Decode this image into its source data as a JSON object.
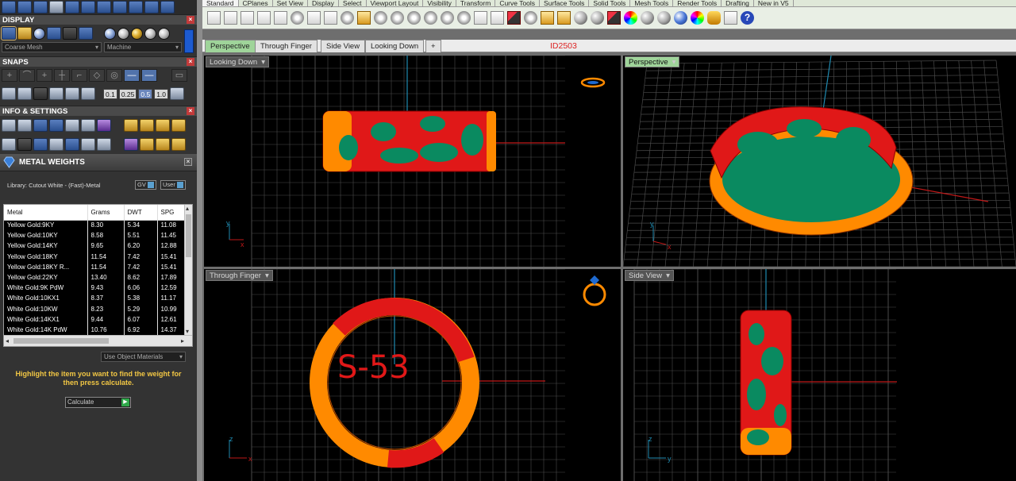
{
  "left_panel": {
    "display_section": {
      "title": "DISPLAY",
      "mesh_dropdown": "Coarse Mesh",
      "render_dropdown": "Machine"
    },
    "snaps_section": {
      "title": "SNAPS",
      "values": [
        "0.1",
        "0.25",
        "0.5",
        "1.0"
      ]
    },
    "info_section": {
      "title": "INFO & SETTINGS"
    },
    "metal_weights": {
      "title": "METAL WEIGHTS",
      "library_label": "Library: Cutout White - (Fast)-Metal",
      "gv_label": "GV",
      "user_label": "User",
      "columns": [
        "Metal",
        "Grams",
        "DWT",
        "SPG"
      ],
      "rows": [
        [
          "Yellow Gold:9KY",
          "8.30",
          "5.34",
          "11.08"
        ],
        [
          "Yellow Gold:10KY",
          "8.58",
          "5.51",
          "11.45"
        ],
        [
          "Yellow Gold:14KY",
          "9.65",
          "6.20",
          "12.88"
        ],
        [
          "Yellow Gold:18KY",
          "11.54",
          "7.42",
          "15.41"
        ],
        [
          "Yellow Gold:18KY R...",
          "11.54",
          "7.42",
          "15.41"
        ],
        [
          "Yellow Gold:22KY",
          "13.40",
          "8.62",
          "17.89"
        ],
        [
          "White Gold:9K PdW",
          "9.43",
          "6.06",
          "12.59"
        ],
        [
          "White Gold:10KX1",
          "8.37",
          "5.38",
          "11.17"
        ],
        [
          "White Gold:10KW",
          "8.23",
          "5.29",
          "10.99"
        ],
        [
          "White Gold:14KX1",
          "9.44",
          "6.07",
          "12.61"
        ],
        [
          "White Gold:14K PdW",
          "10.76",
          "6.92",
          "14.37"
        ]
      ],
      "use_object_materials": "Use Object Materials",
      "hint": "Highlight the item you want to find the weight for then press calculate.",
      "calculate_label": "Calculate"
    }
  },
  "menubar": {
    "items": [
      "Standard",
      "CPlanes",
      "Set View",
      "Display",
      "Select",
      "Viewport Layout",
      "Visibility",
      "Transform",
      "Curve Tools",
      "Surface Tools",
      "Solid Tools",
      "Mesh Tools",
      "Render Tools",
      "Drafting",
      "New in V5"
    ]
  },
  "toolbar_icons": [
    "new-file-icon",
    "open-folder-icon",
    "save-icon",
    "print-icon",
    "import-icon",
    "cut-icon",
    "copy-icon",
    "paste-icon",
    "undo-icon",
    "pan-hand-icon",
    "rotate-view-icon",
    "zoom-icon",
    "zoom-window-icon",
    "zoom-extents-icon",
    "zoom-selected-icon",
    "undo-view-icon",
    "four-view-icon",
    "set-cplane-icon",
    "car-icon",
    "dimension-icon",
    "object-snap-icon",
    "points-icon",
    "light-icon",
    "lock-icon",
    "layer-icon",
    "material-sphere-icon",
    "shaded-sphere-icon",
    "render-sphere-icon",
    "rendered-sphere-icon",
    "palette-icon",
    "settings-gears-icon",
    "history-icon",
    "help-icon"
  ],
  "view_tabs": [
    "Perspective",
    "Through Finger",
    "Side View",
    "Looking Down",
    "+"
  ],
  "id_label": "ID2503",
  "viewports": {
    "top_left": "Looking Down",
    "top_right": "Perspective",
    "bottom_left": "Through Finger",
    "bottom_right": "Side View"
  },
  "ring_size_label": "S-53",
  "colors": {
    "ring_red": "#e01818",
    "ring_gold": "#ff8a00",
    "ring_green": "#0a8a60",
    "grid": "#4a4a4a",
    "axis_x": "#c01818",
    "axis_y": "#1f8ab0"
  }
}
